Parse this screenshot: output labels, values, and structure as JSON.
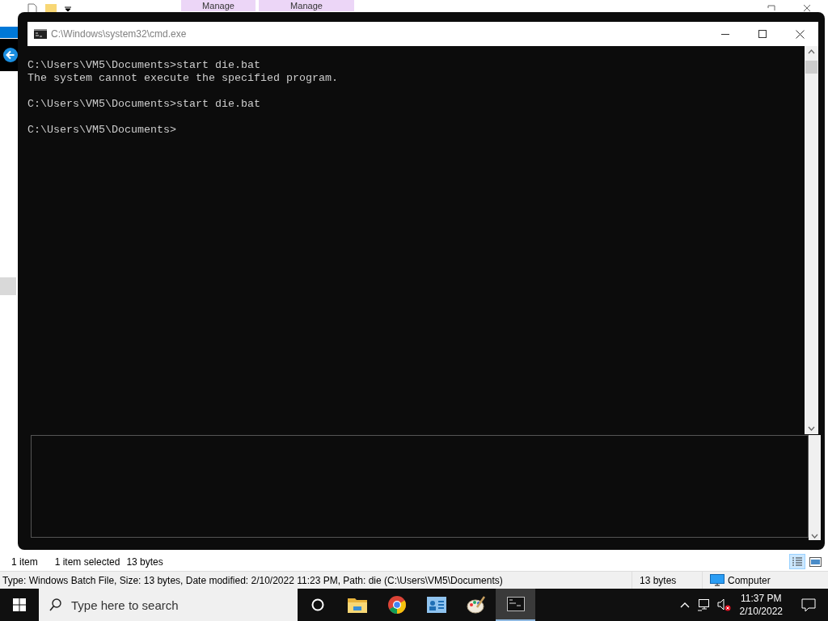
{
  "explorer": {
    "ribbon_tabs": [
      "Manage",
      "Manage"
    ],
    "status_bar": {
      "item_count": "1 item",
      "selection": "1 item selected",
      "size": "13 bytes"
    },
    "details_bar": {
      "description": "Type: Windows Batch File, Size: 13 bytes, Date modified: 2/10/2022 11:23 PM, Path: die (C:\\Users\\VM5\\Documents)",
      "size": "13 bytes",
      "location": "Computer"
    }
  },
  "console": {
    "title": "C:\\Windows\\system32\\cmd.exe",
    "blocks": [
      [
        "C:\\Users\\VM5\\Documents>start die.bat",
        "The system cannot execute the specified program."
      ],
      [
        "C:\\Users\\VM5\\Documents>start die.bat"
      ],
      [
        "C:\\Users\\VM5\\Documents>"
      ]
    ]
  },
  "taskbar": {
    "search": {
      "placeholder": "Type here to search"
    },
    "apps": [
      {
        "kind": "taskview",
        "selected": false
      },
      {
        "kind": "folder",
        "selected": false
      },
      {
        "kind": "browser",
        "selected": false
      },
      {
        "kind": "card",
        "selected": false
      },
      {
        "kind": "paint",
        "selected": false
      },
      {
        "kind": "terminal",
        "selected": true
      }
    ],
    "clock": {
      "time": "11:37 PM",
      "date": "2/10/2022"
    }
  }
}
